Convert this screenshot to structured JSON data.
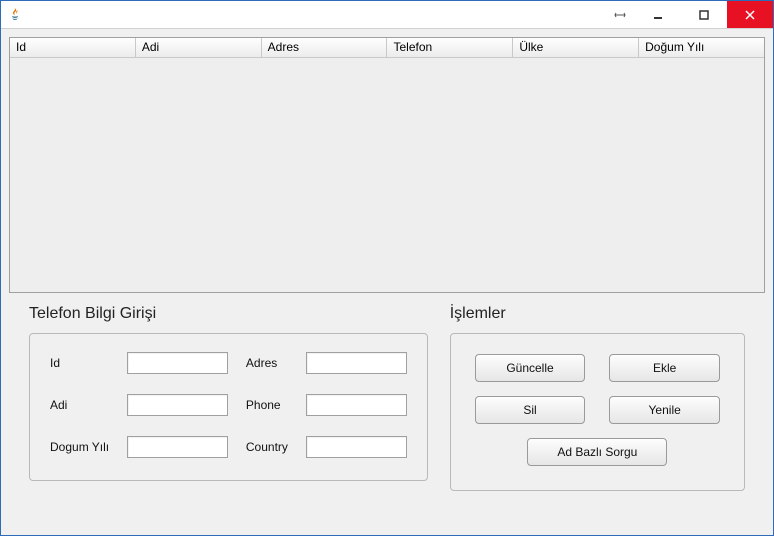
{
  "window": {
    "title": ""
  },
  "table": {
    "columns": [
      "Id",
      "Adi",
      "Adres",
      "Telefon",
      "Ülke",
      "Doğum Yılı"
    ]
  },
  "formPanel": {
    "title": "Telefon Bilgi Girişi",
    "labels": {
      "id": "Id",
      "adi": "Adi",
      "dogumYili": "Dogum Yılı",
      "adres": "Adres",
      "phone": "Phone",
      "country": "Country"
    },
    "values": {
      "id": "",
      "adi": "",
      "dogumYili": "",
      "adres": "",
      "phone": "",
      "country": ""
    }
  },
  "actionsPanel": {
    "title": "İşlemler",
    "buttons": {
      "guncelle": "Güncelle",
      "ekle": "Ekle",
      "sil": "Sil",
      "yenile": "Yenile",
      "adBazliSorgu": "Ad Bazlı Sorgu"
    }
  }
}
